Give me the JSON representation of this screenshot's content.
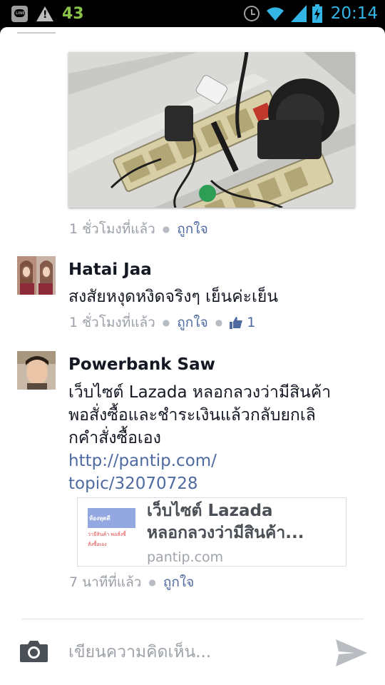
{
  "status_bar": {
    "notification_count": "43",
    "time": "20:14",
    "icons": [
      "line-app-icon",
      "warning-icon",
      "alarm-icon",
      "wifi-icon",
      "signal-icon",
      "battery-charging-icon"
    ],
    "line_label": "LINE"
  },
  "comments": [
    {
      "attachment": "photo-power-strip",
      "time": "1 ชั่วโมงที่แล้ว",
      "like_label": "ถูกใจ"
    },
    {
      "author": "Hatai Jaa",
      "text": "สงสัยหงุดหงิดจริงๆ เย็นค่ะเย็น",
      "time": "1 ชั่วโมงที่แล้ว",
      "like_label": "ถูกใจ",
      "like_count": "1"
    },
    {
      "author": "Powerbank Saw",
      "text_lines": [
        "เว็บไซต์ Lazada หลอกลวงว่ามีสินค้า",
        "พอสั่งซื้อและชำระเงินแล้วกลับยกเลิ",
        "กคำสั่งซื้อเอง"
      ],
      "link_lines": [
        "http://pantip.com/",
        "topic/32070728"
      ],
      "preview": {
        "title_lines": [
          "เว็บไซต์ Lazada",
          "หลอกลวงว่ามีสินค้า..."
        ],
        "domain": "pantip.com",
        "thumb_header": "ห้องหุดดี",
        "thumb_line1": "ว่ามีสินค้า พอสั่งซื้",
        "thumb_line2": "สั่งซื้อเอง"
      },
      "time": "7 นาทีที่แล้ว",
      "like_label": "ถูกใจ"
    }
  ],
  "composer": {
    "placeholder": "เขียนความคิดเห็น...",
    "camera_icon": "camera-icon",
    "send_icon": "send-icon"
  },
  "colors": {
    "link_blue": "#4e6aa0",
    "meta_gray": "#9a9fa8",
    "clock_blue": "#33b5e5",
    "count_green": "#8bc34a"
  }
}
